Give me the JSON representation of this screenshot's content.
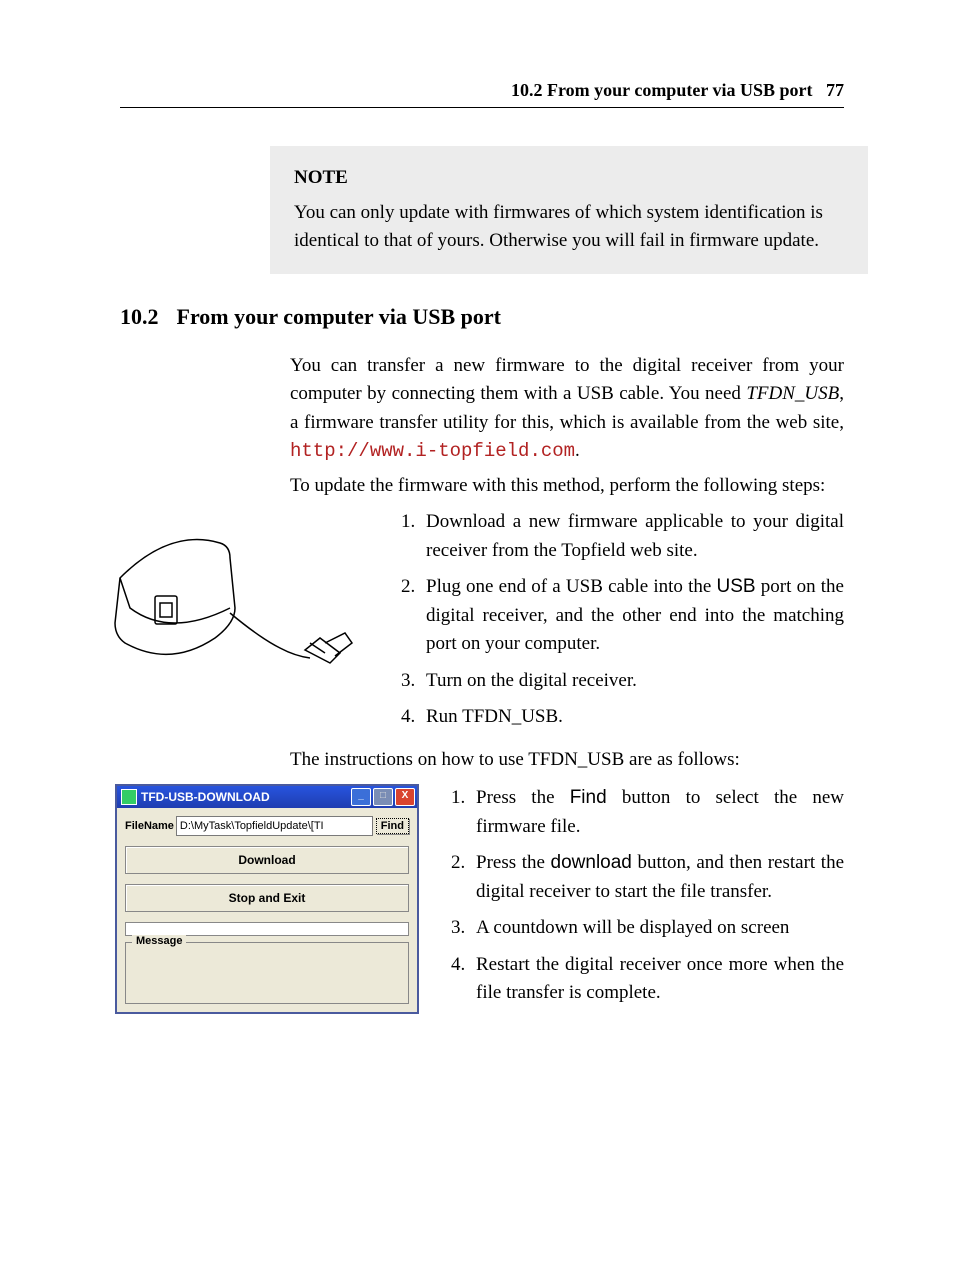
{
  "header": {
    "section": "10.2 From your computer via USB port",
    "page": "77"
  },
  "note": {
    "title": "NOTE",
    "body": "You can only update with firmwares of which system identification is identical to that of yours. Otherwise you will fail in firmware update."
  },
  "section": {
    "number": "10.2",
    "title": "From your computer via USB port"
  },
  "intro": {
    "p1a": "You can transfer a new firmware to the digital receiver from your computer by connecting them with a USB cable. You need ",
    "p1b": "TFDN_USB",
    "p1c": ", a firmware transfer utility for this, which is available from the web site, ",
    "p1_link": "http://www.i-topfield.com",
    "p1d": ".",
    "p2": "To update the firmware with this method, perform the following steps:"
  },
  "steps1": {
    "s1": "Download a new firmware applicable to your digital receiver from the Topfield web site.",
    "s2a": "Plug one end of a USB cable into the ",
    "s2b": "USB",
    "s2c": " port on the digital receiver, and the other end into the matching port on your computer.",
    "s3": "Turn on the digital receiver.",
    "s4a": "Run ",
    "s4b": "TFDN_USB",
    "s4c": "."
  },
  "mid": {
    "a": "The instructions on how to use ",
    "b": "TFDN_USB",
    "c": " are as follows:"
  },
  "app": {
    "title": "TFD-USB-DOWNLOAD",
    "filename_label": "FileName",
    "filename_value": "D:\\MyTask\\TopfieldUpdate\\[TI",
    "find": "Find",
    "download": "Download",
    "stop": "Stop and Exit",
    "message": "Message",
    "min": "_",
    "max": "□",
    "close": "X"
  },
  "steps2": {
    "s1a": "Press the ",
    "s1b": "Find",
    "s1c": " button to select the new firmware file.",
    "s2a": "Press the ",
    "s2b": "download",
    "s2c": " button, and then restart the digital receiver to start the file transfer.",
    "s3": "A countdown will be displayed on screen",
    "s4": "Restart the digital receiver once more when the file transfer is complete."
  }
}
